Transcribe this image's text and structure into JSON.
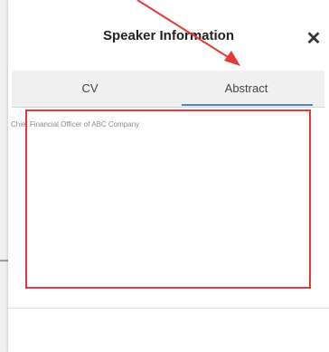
{
  "modal": {
    "title": "Speaker Information",
    "close_symbol": "✕"
  },
  "tabs": [
    {
      "label": "CV",
      "selected": false
    },
    {
      "label": "Abstract",
      "selected": true
    }
  ],
  "content": {
    "text": "Chief Financial Officer of ABC Company"
  },
  "colors": {
    "annotation": "#e53935",
    "tab_underline": "#4a8ac9"
  }
}
